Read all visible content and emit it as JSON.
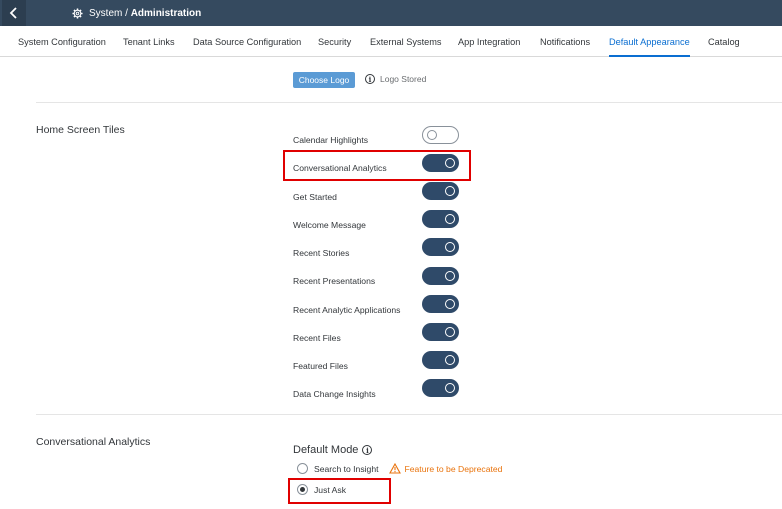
{
  "shell": {
    "title_prefix": "System / ",
    "title_main": "Administration",
    "back_icon": "chevron-left-icon",
    "title_icon": "gear-icon"
  },
  "tabs": [
    {
      "label": "System Configuration",
      "active": false
    },
    {
      "label": "Tenant Links",
      "active": false
    },
    {
      "label": "Data Source Configuration",
      "active": false
    },
    {
      "label": "Security",
      "active": false
    },
    {
      "label": "External Systems",
      "active": false
    },
    {
      "label": "App Integration",
      "active": false
    },
    {
      "label": "Notifications",
      "active": false
    },
    {
      "label": "Default Appearance",
      "active": true
    },
    {
      "label": "Catalog",
      "active": false
    }
  ],
  "logo": {
    "button_label": "Choose Logo",
    "status": "Logo Stored"
  },
  "home_tiles": {
    "title": "Home Screen Tiles",
    "items": [
      {
        "label": "Calendar Highlights",
        "on": false
      },
      {
        "label": "Conversational Analytics",
        "on": true
      },
      {
        "label": "Get Started",
        "on": true
      },
      {
        "label": "Welcome Message",
        "on": true
      },
      {
        "label": "Recent Stories",
        "on": true
      },
      {
        "label": "Recent Presentations",
        "on": true
      },
      {
        "label": "Recent Analytic Applications",
        "on": true
      },
      {
        "label": "Recent Files",
        "on": true
      },
      {
        "label": "Featured Files",
        "on": true
      },
      {
        "label": "Data Change Insights",
        "on": true
      }
    ]
  },
  "conversational": {
    "title": "Conversational Analytics",
    "default_mode_label": "Default Mode",
    "options": [
      {
        "label": "Search to Insight",
        "checked": false,
        "warning": "Feature to be Deprecated"
      },
      {
        "label": "Just Ask",
        "checked": true
      }
    ]
  },
  "colors": {
    "shell": "#354a5f",
    "accent": "#0a6ed1",
    "switch_on": "#2f4a69",
    "highlight": "#e00000",
    "warning": "#e9730c"
  }
}
